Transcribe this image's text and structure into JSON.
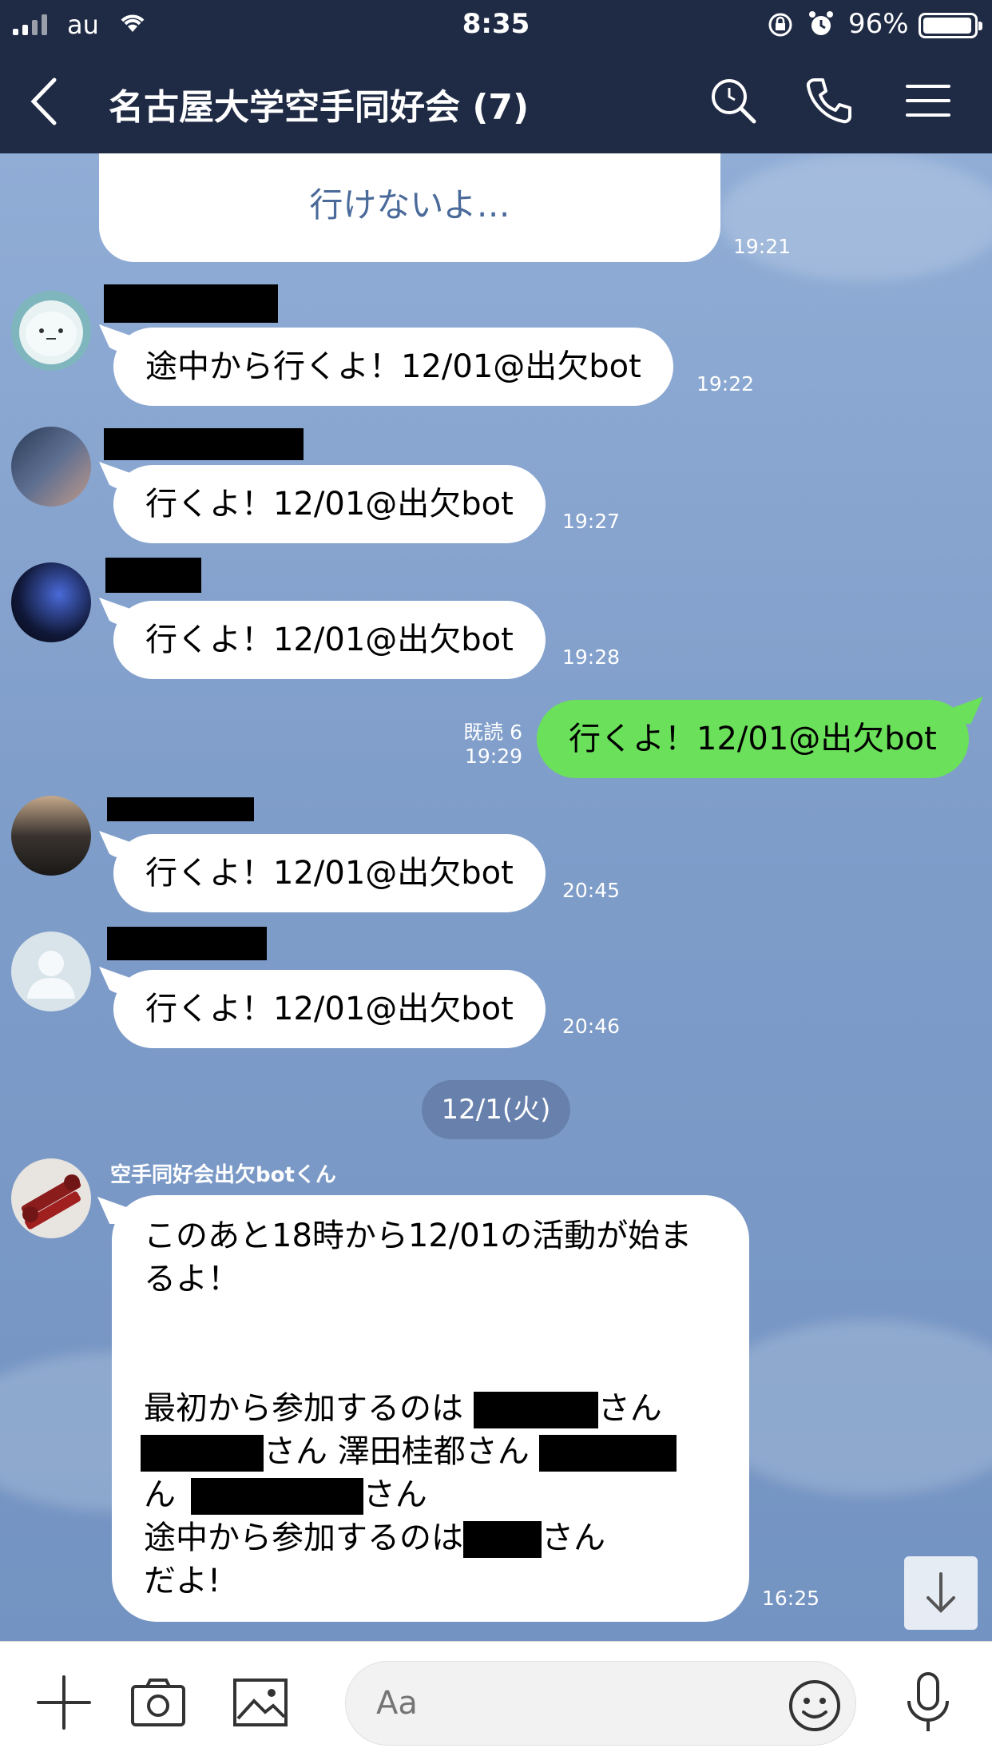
{
  "status_bar": {
    "carrier": "au",
    "time": "8:35",
    "battery_percent_text": "96%",
    "battery_level": 0.96,
    "icons": [
      "signal-icon",
      "wifi-icon",
      "orientation-lock-icon",
      "alarm-icon",
      "battery-icon"
    ]
  },
  "header": {
    "title": "名古屋大学空手同好会 (7)",
    "icons": [
      "back-chevron-icon",
      "search-icon",
      "phone-icon",
      "menu-icon"
    ]
  },
  "messages": [
    {
      "id": "m0",
      "text": "行けないよ…",
      "time": "19:21"
    },
    {
      "id": "m1",
      "text": "途中から行くよ！12/01@出欠bot",
      "time": "19:22"
    },
    {
      "id": "m2",
      "text": "行くよ！12/01@出欠bot",
      "time": "19:27"
    },
    {
      "id": "m3",
      "text": "行くよ！12/01@出欠bot",
      "time": "19:28"
    },
    {
      "id": "m4",
      "text": "行くよ！12/01@出欠bot",
      "time": "19:29",
      "read": "既読 6",
      "own": true
    },
    {
      "id": "m5",
      "text": "行くよ！12/01@出欠bot",
      "time": "20:45"
    },
    {
      "id": "m6",
      "text": "行くよ！12/01@出欠bot",
      "time": "20:46"
    }
  ],
  "date_separator": "12/1(火)",
  "bot_message": {
    "sender": "空手同好会出欠botくん",
    "line1": "このあと18時から12/01の活動が始ま",
    "line2": "るよ！",
    "line3": "最初から参加するのは",
    "san": "さん",
    "sawada": "さん 澤田桂都さん",
    "line5_prefix": "ん",
    "line6": "途中から参加するのは",
    "line7": "だよ!",
    "time": "16:25"
  },
  "input": {
    "placeholder": "Aa",
    "icons": [
      "plus-icon",
      "camera-icon",
      "image-icon",
      "emoji-icon",
      "mic-icon"
    ]
  },
  "scroll_down_icon": "arrow-down-icon",
  "colors": {
    "header_bg": "#1f2a44",
    "chat_bg": "#8aa6cf",
    "own_bubble": "#6be05a",
    "other_bubble": "#ffffff",
    "incoming_text_m0": "#4a6a9a"
  }
}
